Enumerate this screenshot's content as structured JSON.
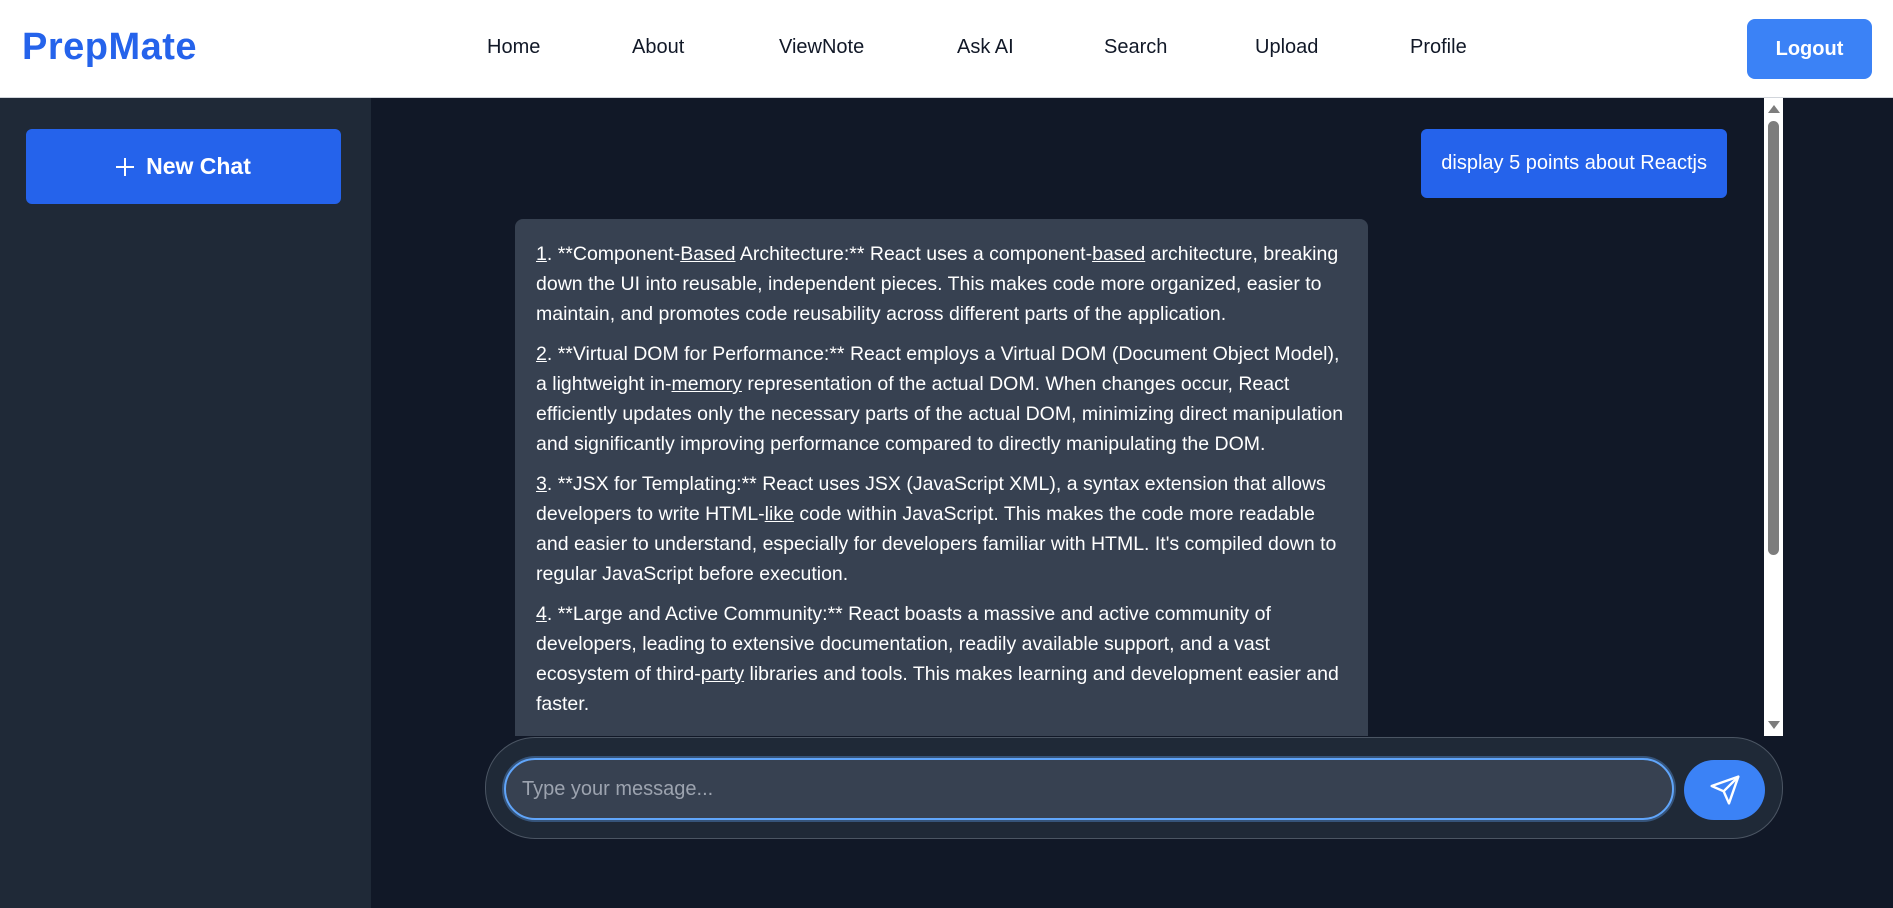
{
  "header": {
    "brand": "PrepMate",
    "nav": [
      {
        "label": "Home"
      },
      {
        "label": "About"
      },
      {
        "label": "ViewNote"
      },
      {
        "label": "Ask AI"
      },
      {
        "label": "Search"
      },
      {
        "label": "Upload"
      },
      {
        "label": "Profile"
      }
    ],
    "logout_label": "Logout"
  },
  "sidebar": {
    "new_chat_label": "New Chat"
  },
  "chat": {
    "user_message": "display 5 points about Reactjs",
    "ai_points": [
      "1. **Component-Based Architecture:** React uses a component-based architecture, breaking down the UI into reusable, independent pieces. This makes code more organized, easier to maintain, and promotes code reusability across different parts of the application.",
      "2. **Virtual DOM for Performance:** React employs a Virtual DOM (Document Object Model), a lightweight in-memory representation of the actual DOM. When changes occur, React efficiently updates only the necessary parts of the actual DOM, minimizing direct manipulation and significantly improving performance compared to directly manipulating the DOM.",
      "3. **JSX for Templating:** React uses JSX (JavaScript XML), a syntax extension that allows developers to write HTML-like code within JavaScript. This makes the code more readable and easier to understand, especially for developers familiar with HTML. It's compiled down to regular JavaScript before execution.",
      "4. **Large and Active Community:** React boasts a massive and active community of developers, leading to extensive documentation, readily available support, and a vast ecosystem of third-party libraries and tools. This makes learning and development easier and faster."
    ]
  },
  "input": {
    "placeholder": "Type your message...",
    "value": ""
  },
  "colors": {
    "brand": "#2563eb",
    "accent": "#3b82f6",
    "page_bg": "#111827",
    "sidebar_bg": "#1f2937",
    "ai_bubble": "#374151"
  },
  "icons": {
    "new_chat": "plus-icon",
    "send": "send-icon"
  }
}
